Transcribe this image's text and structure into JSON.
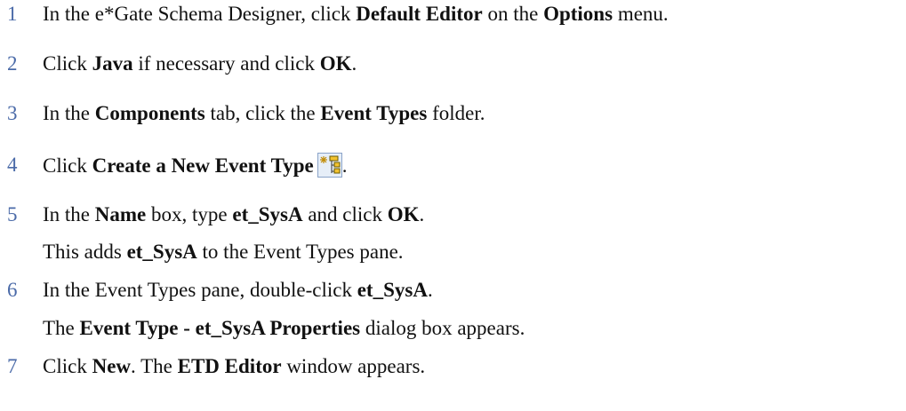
{
  "steps": [
    {
      "num": "1",
      "p": [
        "In the e*Gate Schema Designer, click ",
        "Default Editor",
        " on the ",
        "Options",
        " menu."
      ]
    },
    {
      "num": "2",
      "p": [
        "Click ",
        "Java",
        " if necessary and click ",
        "OK",
        "."
      ]
    },
    {
      "num": "3",
      "p": [
        "In the ",
        "Components",
        " tab, click the ",
        "Event Types",
        " folder."
      ]
    },
    {
      "num": "4",
      "p": [
        "Click ",
        "Create a New Event Type",
        "."
      ],
      "icon": "create-event-type-icon"
    },
    {
      "num": "5",
      "p": [
        "In the ",
        "Name",
        " box, type ",
        "et_SysA",
        " and click ",
        "OK",
        "."
      ]
    },
    {
      "num": "6",
      "p": [
        "In the Event Types pane, double-click ",
        "et_SysA",
        "."
      ]
    },
    {
      "num": "7",
      "p": [
        "Click ",
        "New",
        ". The ",
        "ETD Editor",
        " window appears."
      ]
    }
  ],
  "notes": {
    "after5": [
      "This adds ",
      "et_SysA",
      " to the Event Types pane."
    ],
    "after6": [
      "The ",
      "Event Type - et_SysA Properties",
      " dialog box appears."
    ]
  }
}
